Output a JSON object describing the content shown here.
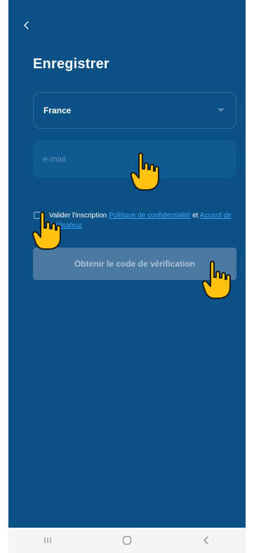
{
  "header": {
    "title": "Enregistrer"
  },
  "country": {
    "selected": "France"
  },
  "email": {
    "placeholder": "e-mail"
  },
  "consent": {
    "prefix": "Valider l'inscription",
    "privacy_link": "Politique de confidentialité",
    "conjunction": "et",
    "agreement_link": "Accord de l'utilisateur"
  },
  "actions": {
    "verify_button": "Obtenir le code de vérification"
  },
  "icons": {
    "back": "chevron-left-icon",
    "dropdown": "caret-down-icon",
    "nav_recent": "recent-apps-icon",
    "nav_home": "home-icon",
    "nav_back": "back-icon",
    "pointer": "hand-pointer-icon"
  },
  "colors": {
    "background": "#0b5186",
    "field": "#0f5a92",
    "button": "#4a79a2",
    "link": "#3aa8ff",
    "pointer": "#ffc20e"
  }
}
